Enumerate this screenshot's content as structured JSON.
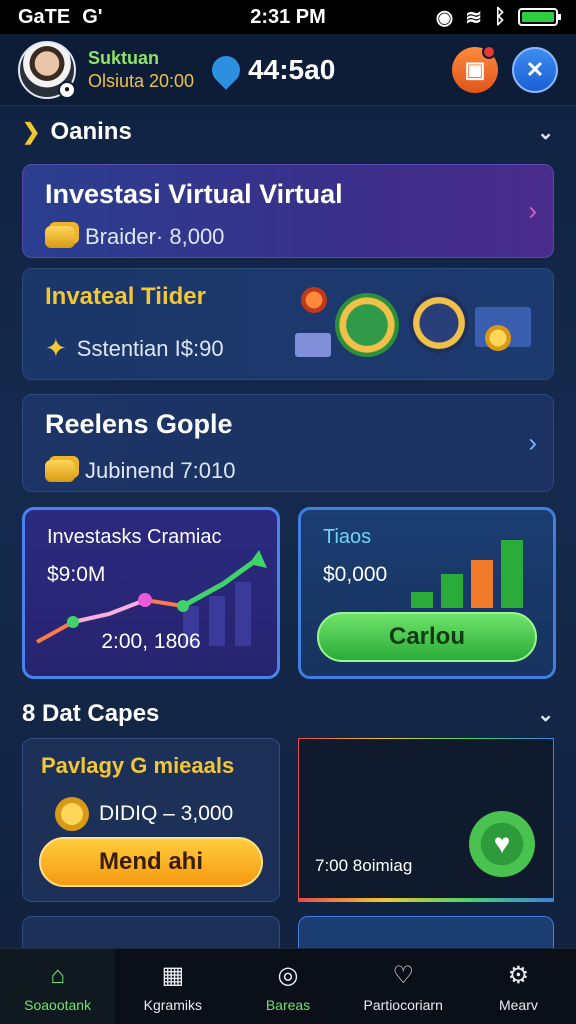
{
  "status_bar": {
    "carrier": "GaTE",
    "extra": "G'",
    "time": "2:31 PM"
  },
  "header": {
    "user_name": "Suktuan",
    "user_sub": "Olsiuta 20:00",
    "balance": "44:5a0"
  },
  "section_1": {
    "title": "Oanins"
  },
  "cards": [
    {
      "title": "Investasi Virtual Virtual",
      "sub": "Braider· 8,000"
    },
    {
      "title": "Invateal Tiider",
      "sub": "Sstentian I$:90"
    },
    {
      "title": "Reelens Gople",
      "sub": "Jubinend 7:010"
    }
  ],
  "tiles": [
    {
      "title": "Investasks Cramiac",
      "value": "$9:0M",
      "foot": "2:00, 1806"
    },
    {
      "title": "Tiaos",
      "value": "$0,000",
      "button": "Carlou"
    }
  ],
  "section_2": {
    "title": "8 Dat Capes"
  },
  "promo_cards": [
    {
      "title": "Pavlagy G mieaals",
      "value": "DIDIQ – 3,000",
      "button": "Mend ahi"
    },
    {
      "foot": "7:00 8oimiag"
    }
  ],
  "nav": [
    {
      "label": "Soaootank",
      "icon": "home-icon"
    },
    {
      "label": "Kgramiks",
      "icon": "box-icon"
    },
    {
      "label": "Bareas",
      "icon": "record-icon"
    },
    {
      "label": "Partiocoriarn",
      "icon": "users-icon"
    },
    {
      "label": "Mearv",
      "icon": "settings-icon"
    }
  ],
  "colors": {
    "accent_green": "#6ee46a",
    "accent_gold": "#f3c633",
    "accent_blue": "#3f7fe0"
  }
}
